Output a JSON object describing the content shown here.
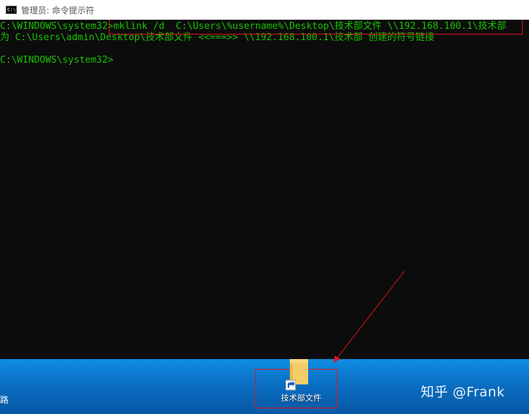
{
  "window": {
    "title": "管理员: 命令提示符",
    "icon": "cmd-icon"
  },
  "console": {
    "lines": [
      "C:\\WINDOWS\\system32>mklink /d  C:\\Users\\%username%\\Desktop\\技术部文件 \\\\192.168.100.1\\技术部",
      "为 C:\\Users\\admin\\Desktop\\技术部文件 <<===>> \\\\192.168.100.1\\技术部 创建的符号链接",
      "",
      "C:\\WINDOWS\\system32>"
    ],
    "text_color": "#17c400",
    "background": "#0c0c0c"
  },
  "desktop": {
    "left_edge_char": "路",
    "shortcut_label": "技术部文件",
    "shortcut_icon": "folder-shortcut-icon",
    "watermark": "知乎 @Frank"
  },
  "annotations": {
    "color": "#e1141a"
  }
}
